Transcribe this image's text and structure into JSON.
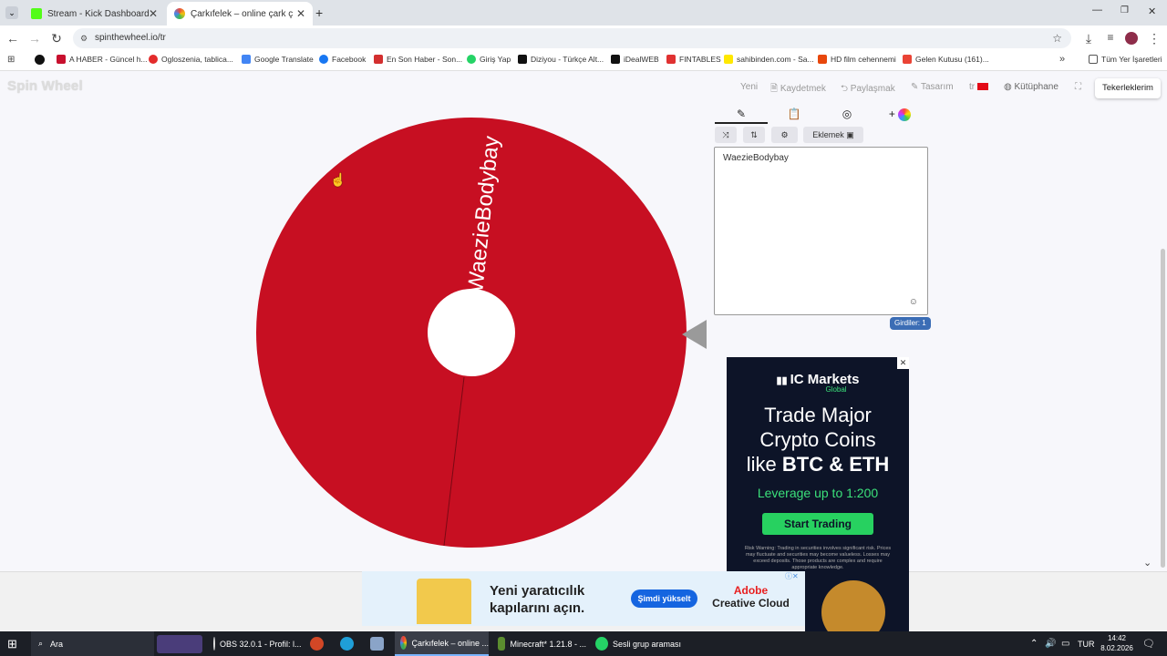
{
  "tabs": [
    {
      "title": "Stream - Kick Dashboard",
      "color": "#53fc18",
      "active": false
    },
    {
      "title": "Çarkıfelek – online çark çevirme",
      "color": "#e94b3c",
      "active": true
    }
  ],
  "address": {
    "url": "spinthewheel.io/tr"
  },
  "bookmarks": [
    {
      "label": "A HABER - Güncel h...",
      "color": "#c8102e"
    },
    {
      "label": "Ogloszenia, tablica...",
      "color": "#e32b2b"
    },
    {
      "label": "Google Translate",
      "color": "#4285f4"
    },
    {
      "label": "Facebook",
      "color": "#1877f2"
    },
    {
      "label": "En Son Haber - Son...",
      "color": "#d32f2f"
    },
    {
      "label": "Giriş Yap",
      "color": "#25d366"
    },
    {
      "label": "Diziyou - Türkçe Alt...",
      "color": "#111111"
    },
    {
      "label": "iDealWEB",
      "color": "#111111"
    },
    {
      "label": "FINTABLES",
      "color": "#e03131"
    },
    {
      "label": "sahibinden.com - Sa...",
      "color": "#ffe800"
    },
    {
      "label": "HD film cehennemi",
      "color": "#e8470c"
    },
    {
      "label": "Gelen Kutusu (161)...",
      "color": "#ea4335"
    }
  ],
  "bookmarks_all": "Tüm Yer İşaretleri",
  "site": {
    "logo": "Spin Wheel",
    "nav": [
      "Yeni",
      "Kaydetmek",
      "Paylaşmak",
      "Tasarım",
      "tr",
      "Kütüphane"
    ],
    "wheels_button": "Tekerleklerim"
  },
  "wheel": {
    "segments": [
      {
        "label": "WaezieBodybay",
        "color": "#c70f22"
      }
    ],
    "pointer_color": "#9a9a9a"
  },
  "editor": {
    "tab_icons": [
      "pencil-icon",
      "clipboard-icon",
      "eye-off-icon",
      "plus-color-icon"
    ],
    "tools": [
      "shuffle-icon",
      "sort-icon",
      "settings-icon"
    ],
    "add_label": "Eklemek",
    "entries_text": "WaezieBodybay",
    "entries_count": "Girdiler: 1"
  },
  "ad_right": {
    "brand": "IC Markets",
    "brand_sub": "Global",
    "headline_1": "Trade Major",
    "headline_2": "Crypto Coins",
    "headline_3a": "like ",
    "headline_3b": "BTC & ETH",
    "leverage": "Leverage up to 1:200",
    "cta": "Start Trading",
    "risk": "Risk Warning: Trading in securities involves significant risk. Prices may fluctuate and securities may become valueless. Losses may exceed deposits. Those products are complex and require appropriate knowledge."
  },
  "ad_bottom": {
    "text_1": "Yeni yaratıcılık",
    "text_2": "kapılarını açın.",
    "cta": "Şimdi yükselt",
    "brand_1": "Adobe",
    "brand_2": "Creative Cloud"
  },
  "taskbar": {
    "search": "Ara",
    "apps": [
      "OBS 32.0.1 - Profil: l...",
      "Çarkıfelek – online ...",
      "Minecraft* 1.21.8 - ...",
      "Sesli grup araması"
    ],
    "lang": "TUR",
    "time": "14:42",
    "date": "8.02.2026"
  }
}
